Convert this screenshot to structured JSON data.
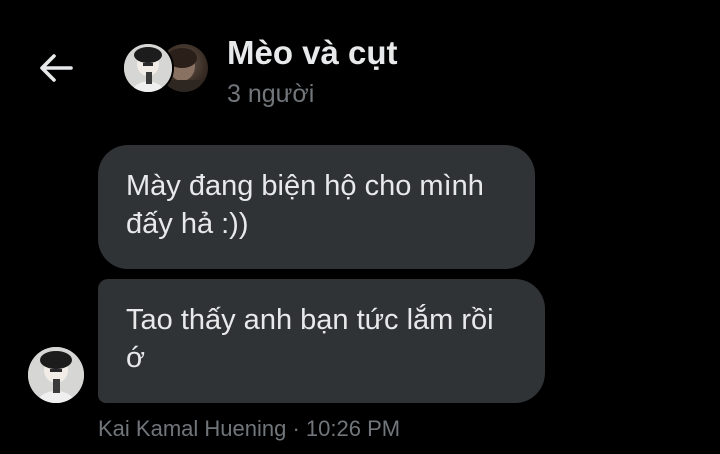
{
  "header": {
    "back_icon": "arrow-left-icon",
    "title": "Mèo và cụt",
    "subtitle": "3 người"
  },
  "messages": [
    {
      "line1": "Mày đang biện hộ cho mình",
      "line2": "đấy hả :))"
    },
    {
      "line1": "Tao thấy anh bạn tức lắm rồi",
      "line2": "ớ"
    }
  ],
  "meta": {
    "sender": "Kai Kamal Huening",
    "separator": " · ",
    "time": "10:26 PM"
  },
  "colors": {
    "background": "#000000",
    "bubble": "#2f3336",
    "text": "#e7e9ea",
    "muted": "#71767b"
  }
}
